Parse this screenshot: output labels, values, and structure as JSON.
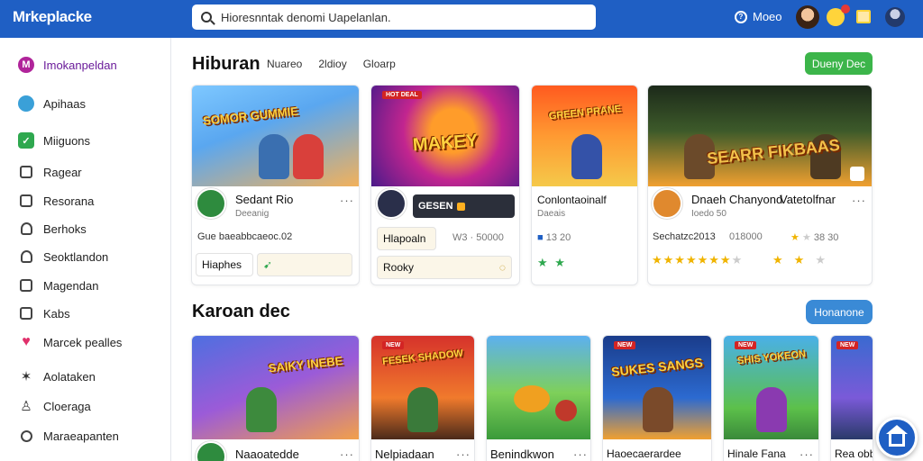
{
  "topbar": {
    "brand": "Mrkeplacke",
    "search_placeholder": "Hioresnntak denomi Uapelanlan.",
    "help_label": "Moeo"
  },
  "sidebar": {
    "items": [
      {
        "label": "Imokanpeldan",
        "icon": "brand-icon"
      },
      {
        "label": "Apihaas",
        "icon": "chat-icon"
      },
      {
        "label": "Miiguons",
        "icon": "check-icon"
      },
      {
        "label": "Ragear",
        "icon": "box-icon"
      },
      {
        "label": "Resorana",
        "icon": "box-icon"
      },
      {
        "label": "Berhoks",
        "icon": "user-icon"
      },
      {
        "label": "Seoktlandon",
        "icon": "bag-icon"
      },
      {
        "label": "Magendan",
        "icon": "box-icon"
      },
      {
        "label": "Kabs",
        "icon": "box-icon"
      },
      {
        "label": "Marcek pealles",
        "icon": "heart-icon"
      },
      {
        "label": "Aolataken",
        "icon": "star-icon"
      },
      {
        "label": "Cloeraga",
        "icon": "person-icon"
      },
      {
        "label": "Maraeapanten",
        "icon": "search-icon"
      }
    ]
  },
  "section1": {
    "title": "Hiburan",
    "tabs": [
      "Nuareo",
      "2ldioy",
      "Gloarp"
    ],
    "button": "Dueny Dec"
  },
  "section2": {
    "title": "Karoan dec",
    "button": "Honanone"
  },
  "cards1": [
    {
      "art": "SOMOR GUMMIE",
      "name": "Sedant Rio",
      "sub": "Deeanig",
      "info": "Gue baeabbcaeoc.02",
      "pill": "Hiaphes",
      "tag": ""
    },
    {
      "art": "MAKEY",
      "name": "",
      "sub": "",
      "dark": "GESEN",
      "pill": "Hlapoaln",
      "info": "W3 · 50000",
      "pill2": "Rooky",
      "tag": "HOT DEAL"
    },
    {
      "art": "GREEN PRANE",
      "name": "Conlontaoinalf",
      "sub": "Daeais",
      "info": "13 20",
      "tag": ""
    },
    {
      "art": "SEARR FIKBAAS",
      "name": "Dnaeh Chanyond",
      "name2": "Vatetolfnar",
      "sub": "Ioedo 50",
      "info": "Sechatzc2013",
      "info2": "018000",
      "info3": "38 30",
      "tag": ""
    }
  ],
  "cards2": [
    {
      "art": "SAIKY INEBE",
      "name": "Naaoatedde",
      "tag": ""
    },
    {
      "art": "FESEK SHADOW",
      "name": "Nelpiadaan",
      "tag": "NEW"
    },
    {
      "art": "",
      "name": "Benindkwon",
      "tag": ""
    },
    {
      "art": "SUKES SANGS",
      "name": "Haoecaerardee",
      "tag": "NEW"
    },
    {
      "art": "SHIS YOKEON",
      "name": "Hinale Fana",
      "tag": "NEW"
    },
    {
      "art": "",
      "name": "Rea obba",
      "tag": "NEW"
    }
  ]
}
